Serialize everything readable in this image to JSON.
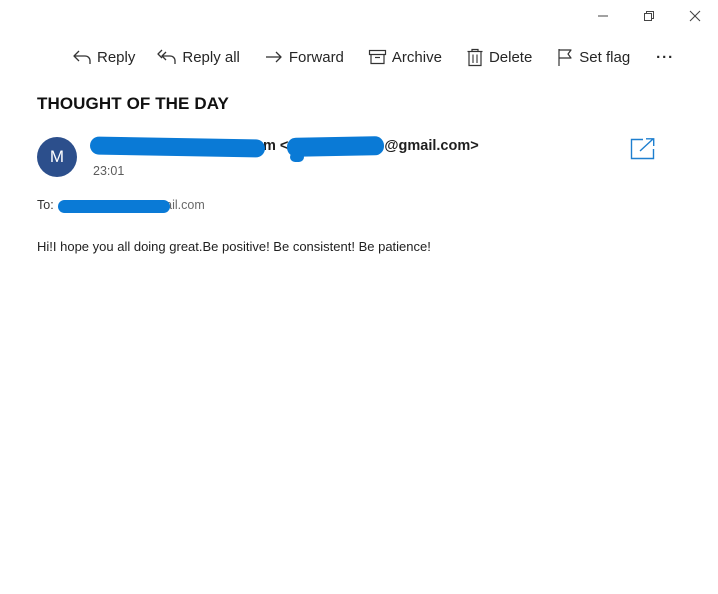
{
  "window": {
    "controls": [
      "minimize",
      "restore",
      "close"
    ]
  },
  "toolbar": {
    "reply_label": "Reply",
    "reply_all_label": "Reply all",
    "forward_label": "Forward",
    "archive_label": "Archive",
    "delete_label": "Delete",
    "set_flag_label": "Set flag",
    "more_label": "···"
  },
  "message": {
    "subject": "THOUGHT OF THE DAY",
    "avatar_initial": "M",
    "sender_visible_text": "m <",
    "sender_email_suffix": "@gmail.com>",
    "time": "23:01",
    "to_label": "To:",
    "to_visible_suffix": "ail.com",
    "body": "Hi!I hope you all doing great.Be positive! Be consistent! Be patience!"
  },
  "colors": {
    "avatar_bg": "#2c4f8c",
    "accent": "#0a7ad6",
    "redaction": "#0a7ad6"
  }
}
